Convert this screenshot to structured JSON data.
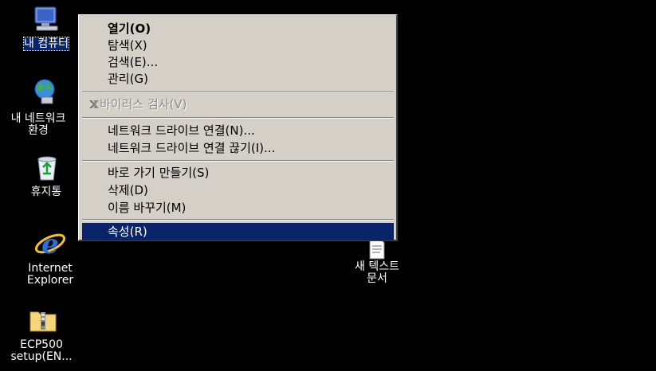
{
  "desktop": {
    "icons": [
      {
        "label_lines": [
          "내 컴퓨터"
        ],
        "selected": true,
        "icon": "my-computer-icon"
      },
      {
        "label_lines": [
          "내 네트워크",
          "환경"
        ],
        "icon": "network-places-icon"
      },
      {
        "label_lines": [
          "휴지통"
        ],
        "icon": "recycle-bin-icon"
      },
      {
        "label_lines": [
          "Internet",
          "Explorer"
        ],
        "icon": "internet-explorer-icon"
      },
      {
        "label_lines": [
          "ECP500",
          "setup(EN..."
        ],
        "icon": "zip-folder-icon"
      },
      {
        "label_lines": [
          "새 텍스트",
          "문서"
        ],
        "icon": "text-document-icon"
      }
    ]
  },
  "context_menu": {
    "items": [
      {
        "label": "열기(O)",
        "style": "bold"
      },
      {
        "label": "탐색(X)"
      },
      {
        "label": "검색(E)..."
      },
      {
        "label": "관리(G)"
      },
      {
        "label": "바이러스 검사(V)",
        "style": "disabled",
        "icon": "antivirus-icon"
      },
      {
        "label": "네트워크 드라이브 연결(N)..."
      },
      {
        "label": "네트워크 드라이브 연결 끊기(I)..."
      },
      {
        "label": "바로 가기 만들기(S)"
      },
      {
        "label": "삭제(D)"
      },
      {
        "label": "이름 바꾸기(M)"
      },
      {
        "label": "속성(R)",
        "style": "highlighted"
      }
    ]
  },
  "colors": {
    "desktop_background": "#000000",
    "menu_background": "#d4d0c8",
    "highlight": "#0a246a",
    "disabled_text": "#8a8a8a"
  }
}
